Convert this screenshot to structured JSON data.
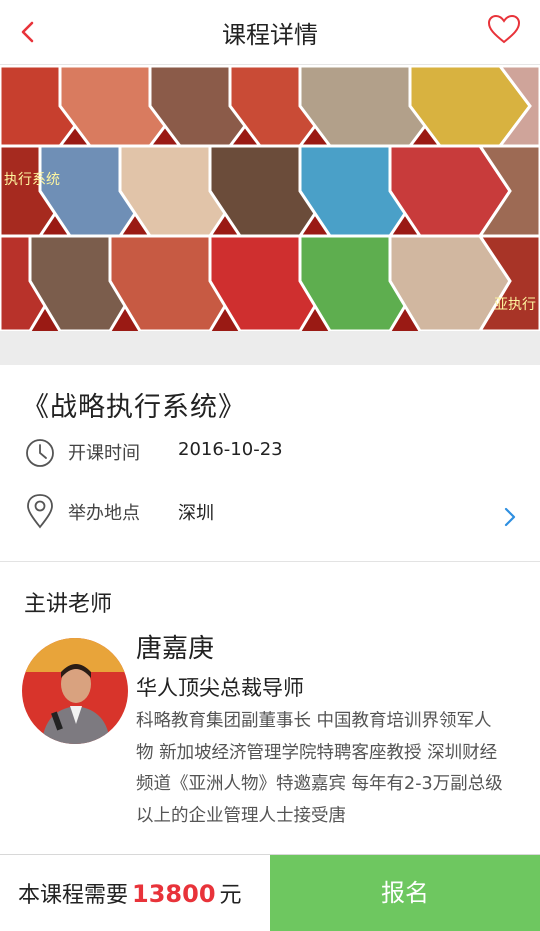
{
  "header": {
    "title": "课程详情",
    "back_icon": "chevron-left-icon",
    "favorite_icon": "heart-outline-icon",
    "accent_color": "#e8333a"
  },
  "banner": {
    "overlay_text_1": "执行系统",
    "overlay_text_2": "亚执行",
    "dominant_color": "#b31515"
  },
  "course": {
    "title": "《战略执行系统》",
    "time_label": "开课时间",
    "time_value": "2016-10-23",
    "place_label": "举办地点",
    "place_value": "深圳",
    "time_icon": "clock-icon",
    "place_icon": "location-pin-icon",
    "more_icon": "chevron-right-icon"
  },
  "teacher": {
    "section_title": "主讲老师",
    "name": "唐嘉庚",
    "role": "华人顶尖总裁导师",
    "bio": "科略教育集团副董事长 中国教育培训界领军人物 新加坡经济管理学院特聘客座教授 深圳财经频道《亚洲人物》特邀嘉宾 每年有2-3万副总级以上的企业管理人士接受唐"
  },
  "footer": {
    "price_prefix": "本课程需要",
    "price_amount": "13800",
    "price_unit": "元",
    "signup_label": "报名",
    "signup_color": "#6ec760",
    "price_color": "#e8333a"
  }
}
